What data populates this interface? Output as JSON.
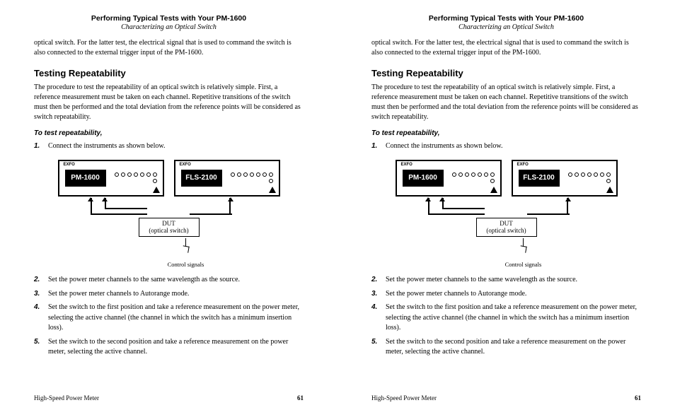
{
  "header": {
    "title": "Performing Typical Tests with Your PM-1600",
    "subtitle": "Characterizing an Optical Switch"
  },
  "lead": "optical switch. For the latter test, the electrical signal that is used to command the switch is also connected to the external trigger input of the PM-1600.",
  "section_heading": "Testing Repeatability",
  "intro": "The procedure to test the repeatability of an optical switch is relatively simple. First, a reference measurement must be taken on each channel. Repetitive transitions of the switch must then be performed and the total deviation from the reference points will be considered as switch repeatability.",
  "procedure_label": "To test repeatability,",
  "steps": {
    "s1": "Connect the instruments as shown below.",
    "s2": "Set the power meter channels to the same wavelength as the source.",
    "s3": "Set the power meter channels to Autorange mode.",
    "s4": "Set the switch to the first position and take a reference measurement on the power meter, selecting the active channel (the channel in which the switch has a minimum insertion loss).",
    "s5": "Set the switch to the second position and take a reference measurement on the power meter, selecting the active channel."
  },
  "nums": {
    "n1": "1.",
    "n2": "2.",
    "n3": "3.",
    "n4": "4.",
    "n5": "5."
  },
  "diagram": {
    "device1": "PM-1600",
    "device2": "FLS-2100",
    "brand": "EXFO",
    "dut_line1": "DUT",
    "dut_line2": "(optical switch)",
    "control": "Control signals"
  },
  "footer": {
    "left": "High-Speed Power Meter",
    "page": "61"
  }
}
